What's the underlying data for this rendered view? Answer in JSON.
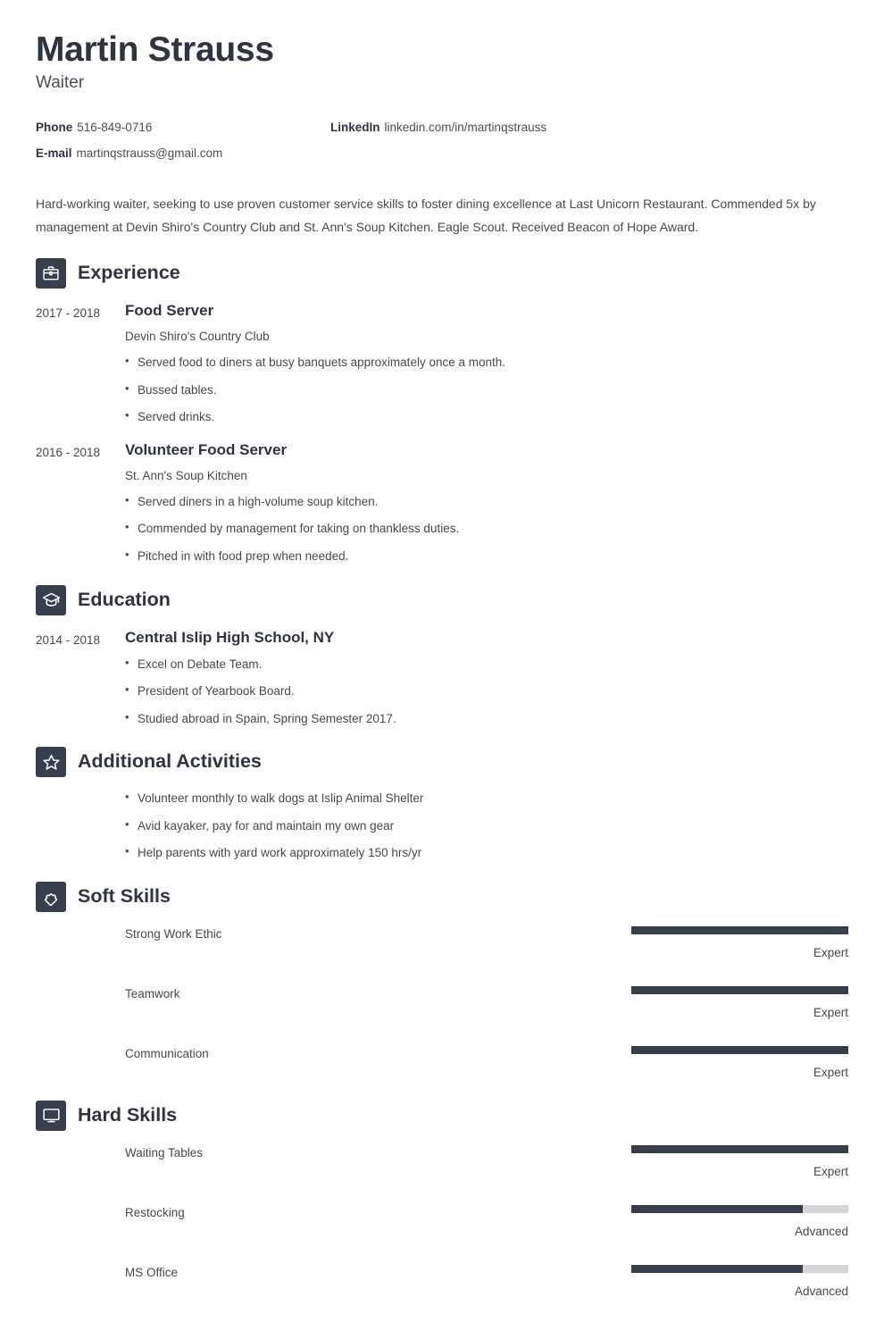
{
  "header": {
    "name": "Martin Strauss",
    "job_title": "Waiter",
    "contacts": [
      {
        "label": "Phone",
        "value": "516-849-0716"
      },
      {
        "label": "LinkedIn",
        "value": "linkedin.com/in/martinqstrauss"
      },
      {
        "label": "E-mail",
        "value": "martinqstrauss@gmail.com"
      }
    ]
  },
  "summary": "Hard-working waiter, seeking to use proven customer service skills to foster dining excellence at Last Unicorn Restaurant. Commended 5x by management at Devin Shiro's Country Club and St. Ann's Soup Kitchen. Eagle Scout. Received Beacon of Hope Award.",
  "sections": {
    "experience": {
      "title": "Experience",
      "icon": "briefcase-icon",
      "entries": [
        {
          "dates": "2017 - 2018",
          "title": "Food Server",
          "org": "Devin Shiro's Country Club",
          "bullets": [
            "Served food to diners at busy banquets approximately once a month.",
            "Bussed tables.",
            "Served drinks."
          ]
        },
        {
          "dates": "2016 - 2018",
          "title": "Volunteer Food Server",
          "org": "St. Ann's Soup Kitchen",
          "bullets": [
            "Served diners in a high-volume soup kitchen.",
            "Commended by management for taking on thankless duties.",
            "Pitched in with food prep when needed."
          ]
        }
      ]
    },
    "education": {
      "title": "Education",
      "icon": "graduation-cap-icon",
      "entries": [
        {
          "dates": "2014 - 2018",
          "title": "Central Islip High School, NY",
          "org": "",
          "bullets": [
            "Excel on Debate Team.",
            "President of Yearbook Board.",
            "Studied abroad in Spain, Spring Semester 2017."
          ]
        }
      ]
    },
    "activities": {
      "title": "Additional Activities",
      "icon": "star-icon",
      "bullets": [
        "Volunteer monthly to walk dogs at Islip Animal Shelter",
        "Avid kayaker, pay for and maintain my own gear",
        "Help parents with yard work approximately 150 hrs/yr"
      ]
    },
    "soft_skills": {
      "title": "Soft Skills",
      "icon": "puzzle-piece-icon",
      "skills": [
        {
          "name": "Strong Work Ethic",
          "level": "Expert",
          "percent": 100
        },
        {
          "name": "Teamwork",
          "level": "Expert",
          "percent": 100
        },
        {
          "name": "Communication",
          "level": "Expert",
          "percent": 100
        }
      ]
    },
    "hard_skills": {
      "title": "Hard Skills",
      "icon": "monitor-icon",
      "skills": [
        {
          "name": "Waiting Tables",
          "level": "Expert",
          "percent": 100
        },
        {
          "name": "Restocking",
          "level": "Advanced",
          "percent": 79
        },
        {
          "name": "MS Office",
          "level": "Advanced",
          "percent": 79
        }
      ]
    }
  },
  "colors": {
    "accent_dark": "#373e4c",
    "heading": "#2e3440",
    "body_text": "#45494f",
    "meter_track": "#d4d6d8",
    "background": "#ffffff"
  }
}
